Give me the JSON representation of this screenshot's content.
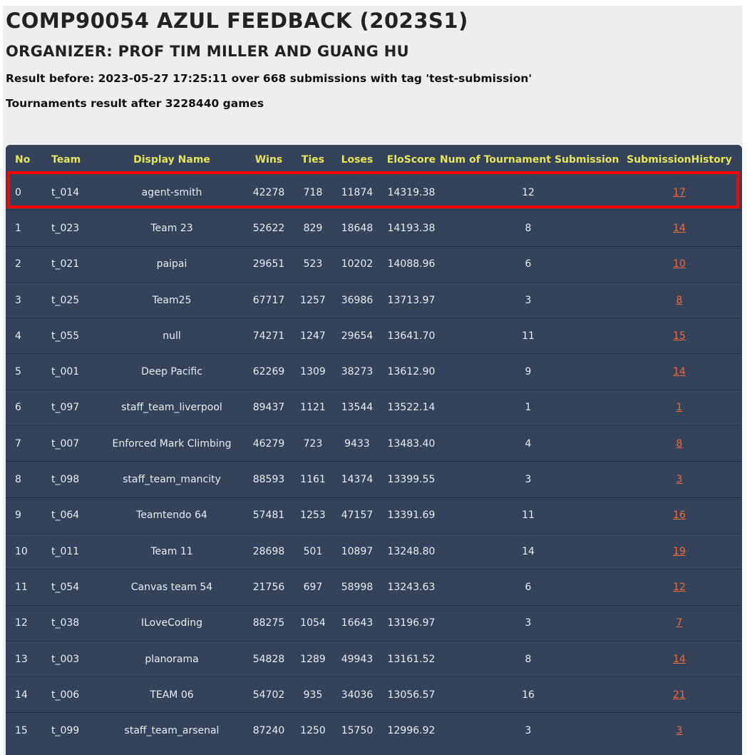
{
  "header": {
    "title": "COMP90054 AZUL FEEDBACK (2023S1)",
    "organizer": "ORGANIZER: PROF TIM MILLER AND GUANG HU",
    "result_line": "Result before: 2023-05-27 17:25:11 over 668 submissions with tag 'test-submission'",
    "tournament_line": "Tournaments result after 3228440 games"
  },
  "table": {
    "columns": [
      "No",
      "Team",
      "Display Name",
      "Wins",
      "Ties",
      "Loses",
      "EloScore",
      "Num of Tournament Submission",
      "SubmissionHistory"
    ],
    "highlighted_row": 0,
    "rows": [
      [
        "0",
        "t_014",
        "agent-smith",
        "42278",
        "718",
        "11874",
        "14319.38",
        "12",
        "17"
      ],
      [
        "1",
        "t_023",
        "Team 23",
        "52622",
        "829",
        "18648",
        "14193.38",
        "8",
        "14"
      ],
      [
        "2",
        "t_021",
        "paipai",
        "29651",
        "523",
        "10202",
        "14088.96",
        "6",
        "10"
      ],
      [
        "3",
        "t_025",
        "Team25",
        "67717",
        "1257",
        "36986",
        "13713.97",
        "3",
        "8"
      ],
      [
        "4",
        "t_055",
        "null",
        "74271",
        "1247",
        "29654",
        "13641.70",
        "11",
        "15"
      ],
      [
        "5",
        "t_001",
        "Deep Pacific",
        "62269",
        "1309",
        "38273",
        "13612.90",
        "9",
        "14"
      ],
      [
        "6",
        "t_097",
        "staff_team_liverpool",
        "89437",
        "1121",
        "13544",
        "13522.14",
        "1",
        "1"
      ],
      [
        "7",
        "t_007",
        "Enforced Mark Climbing",
        "46279",
        "723",
        "9433",
        "13483.40",
        "4",
        "8"
      ],
      [
        "8",
        "t_098",
        "staff_team_mancity",
        "88593",
        "1161",
        "14374",
        "13399.55",
        "3",
        "3"
      ],
      [
        "9",
        "t_064",
        "Teamtendo 64",
        "57481",
        "1253",
        "47157",
        "13391.69",
        "11",
        "16"
      ],
      [
        "10",
        "t_011",
        "Team 11",
        "28698",
        "501",
        "10897",
        "13248.80",
        "14",
        "19"
      ],
      [
        "11",
        "t_054",
        "Canvas team 54",
        "21756",
        "697",
        "58998",
        "13243.63",
        "6",
        "12"
      ],
      [
        "12",
        "t_038",
        "ILoveCoding",
        "88275",
        "1054",
        "16643",
        "13196.97",
        "3",
        "7"
      ],
      [
        "13",
        "t_003",
        "planorama",
        "54828",
        "1289",
        "49943",
        "13161.52",
        "8",
        "14"
      ],
      [
        "14",
        "t_006",
        "TEAM 06",
        "54702",
        "935",
        "34036",
        "13056.57",
        "16",
        "21"
      ],
      [
        "15",
        "t_099",
        "staff_team_arsenal",
        "87240",
        "1250",
        "15750",
        "12996.92",
        "3",
        "3"
      ]
    ]
  },
  "colors": {
    "header_text": "#e4e35a",
    "table_bg": "#34435a",
    "link": "#f06a3a",
    "highlight_border": "#ff0000"
  }
}
